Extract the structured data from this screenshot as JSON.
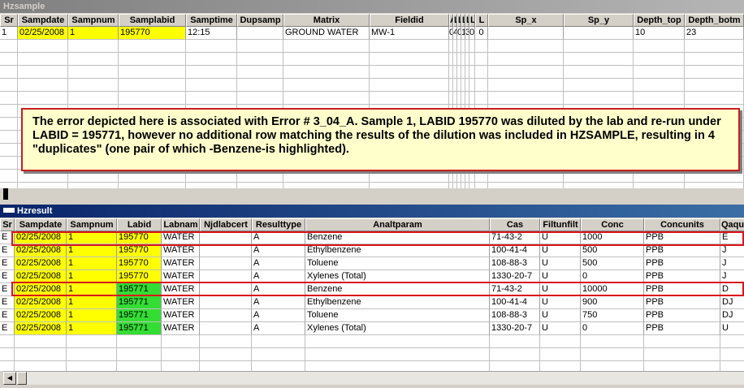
{
  "top_window": {
    "title": "Hzsample",
    "columns": [
      "Sr",
      "Sampdate",
      "Sampnum",
      "Samplabid",
      "Samptime",
      "Dupsamp",
      "Matrix",
      "Fieldid",
      "A",
      "L",
      "L",
      "L",
      "L",
      "L",
      "L",
      "Sp_x",
      "Sp_y",
      "Depth_top",
      "Depth_botm"
    ],
    "rows": [
      [
        "1",
        "02/25/2008",
        "1",
        "195770",
        "12:15",
        "",
        "GROUND WATER",
        "MW-1",
        "0",
        "4",
        "0",
        "1",
        "3",
        "0",
        "0",
        "",
        "",
        "10",
        "23"
      ]
    ]
  },
  "callout": {
    "text": "The error depicted here is associated with Error # 3_04_A. Sample 1, LABID 195770 was diluted by the lab and re-run under LABID = 195771, however no additional row matching the results of the dilution was included in HZSAMPLE, resulting in 4 \"duplicates\" (one pair of which -Benzene-is highlighted)."
  },
  "bottom_window": {
    "title": "Hzresult",
    "columns": [
      "Sr",
      "Sampdate",
      "Sampnum",
      "Labid",
      "Labnam",
      "Njdlabcert",
      "Resulttype",
      "Analtparam",
      "Cas",
      "Filtunfilt",
      "Conc",
      "Concunits",
      "Qaqu"
    ],
    "rows": [
      [
        "E",
        "02/25/2008",
        "1",
        "195770",
        "WATER",
        "",
        "A",
        "Benzene",
        "71-43-2",
        "U",
        "1000",
        "PPB",
        "E"
      ],
      [
        "E",
        "02/25/2008",
        "1",
        "195770",
        "WATER",
        "",
        "A",
        "Ethylbenzene",
        "100-41-4",
        "U",
        "500",
        "PPB",
        "J"
      ],
      [
        "E",
        "02/25/2008",
        "1",
        "195770",
        "WATER",
        "",
        "A",
        "Toluene",
        "108-88-3",
        "U",
        "500",
        "PPB",
        "J"
      ],
      [
        "E",
        "02/25/2008",
        "1",
        "195770",
        "WATER",
        "",
        "A",
        "Xylenes (Total)",
        "1330-20-7",
        "U",
        "0",
        "PPB",
        "J"
      ],
      [
        "E",
        "02/25/2008",
        "1",
        "195771",
        "WATER",
        "",
        "A",
        "Benzene",
        "71-43-2",
        "U",
        "10000",
        "PPB",
        "D"
      ],
      [
        "E",
        "02/25/2008",
        "1",
        "195771",
        "WATER",
        "",
        "A",
        "Ethylbenzene",
        "100-41-4",
        "U",
        "900",
        "PPB",
        "DJ"
      ],
      [
        "E",
        "02/25/2008",
        "1",
        "195771",
        "WATER",
        "",
        "A",
        "Toluene",
        "108-88-3",
        "U",
        "750",
        "PPB",
        "DJ"
      ],
      [
        "E",
        "02/25/2008",
        "1",
        "195771",
        "WATER",
        "",
        "A",
        "Xylenes (Total)",
        "1330-20-7",
        "U",
        "0",
        "PPB",
        "U"
      ]
    ]
  },
  "colors": {
    "highlight_yellow": "#ffff00",
    "highlight_green": "#33dd33",
    "error_red": "#d9141b"
  },
  "icons": {
    "scroll_left": "◀"
  }
}
